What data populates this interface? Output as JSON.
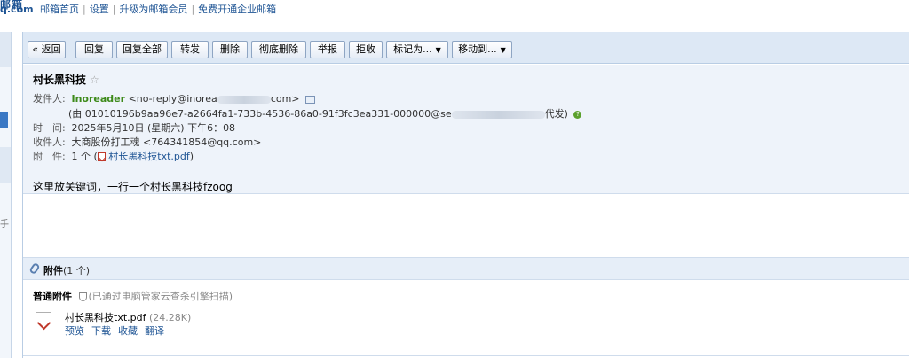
{
  "logo": {
    "line1": "邮箱",
    "line2": "q.com"
  },
  "topnav": {
    "home": "邮箱首页",
    "settings": "设置",
    "upgrade": "升级为邮箱会员",
    "enterprise": "免费开通企业邮箱",
    "separator": "|"
  },
  "leftpanel": {
    "fragment": "手"
  },
  "toolbar": {
    "back": "« 返回",
    "reply": "回复",
    "reply_all": "回复全部",
    "forward": "转发",
    "delete": "删除",
    "delete_permanent": "彻底删除",
    "report": "举报",
    "reject": "拒收",
    "mark_as": "标记为...",
    "move_to": "移动到...",
    "caret": "▼"
  },
  "email": {
    "subject": "村长黑科技",
    "star": "☆",
    "from_label": "发件人:",
    "from_name": "Inoreader",
    "from_addr": "<no-reply@inorea",
    "from_addr_end": "com>",
    "via_prefix": "(由 01010196b9aa96e7-a2664fa1-733b-4536-86a0-91f3fc3ea331-000000@se",
    "via_suffix": "代发)",
    "time_label": "时　间:",
    "time_value": "2025年5月10日 (星期六) 下午6：08",
    "to_label": "收件人:",
    "to_name": "大商股份打工魂",
    "to_addr": "<764341854@qq.com>",
    "att_label": "附　件:",
    "att_count": "1 个 (",
    "att_name": "村长黑科技txt.pdf",
    "att_close": ")",
    "body": "这里放关键词，一行一个村长黑科技fzoog"
  },
  "attachments": {
    "title": "附件",
    "count": "(1 个)",
    "section": "普通附件",
    "scan_note": "(已通过电脑管家云查杀引擎扫描)",
    "file_name": "村长黑科技txt.pdf",
    "file_size": "(24.28K)",
    "actions": {
      "preview": "预览",
      "download": "下载",
      "save": "收藏",
      "translate": "翻译"
    }
  }
}
